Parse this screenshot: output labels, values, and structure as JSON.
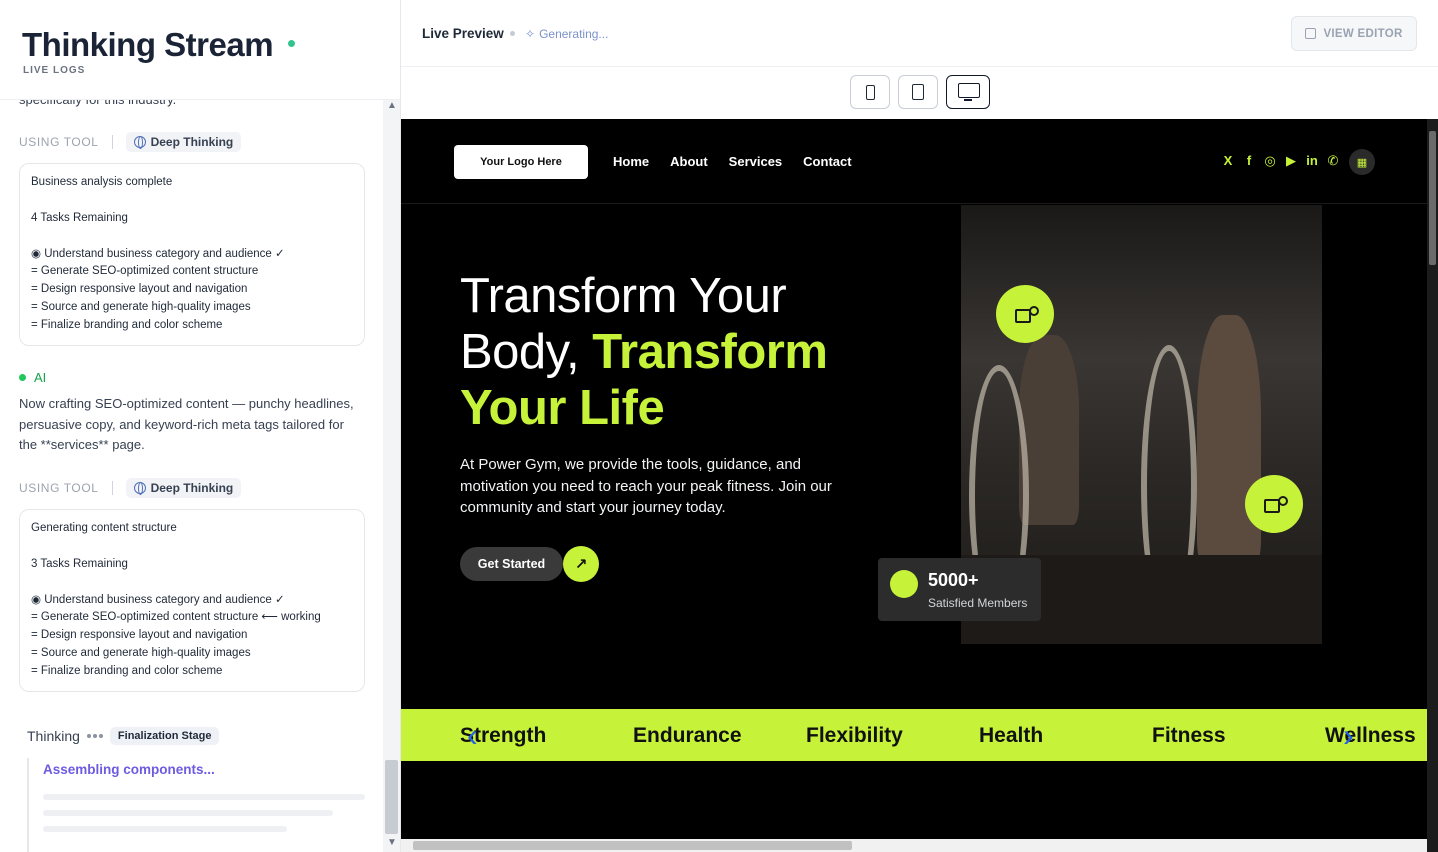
{
  "left": {
    "title": "Thinking Stream",
    "subtitle": "LIVE LOGS",
    "cut_text": "specifically for this industry.",
    "tool_blocks": [
      {
        "label": "USING TOOL",
        "tool": "Deep Thinking",
        "status": "Business analysis complete",
        "remaining": "4 Tasks Remaining",
        "tasks": [
          "◉ Understand business category and audience ✓",
          "= Generate SEO-optimized content structure",
          "= Design responsive layout and navigation",
          "= Source and generate high-quality images",
          "= Finalize branding and color scheme"
        ]
      },
      {
        "label": "USING TOOL",
        "tool": "Deep Thinking",
        "status": "Generating content structure",
        "remaining": "3 Tasks Remaining",
        "tasks": [
          "◉ Understand business category and audience ✓",
          "= Generate SEO-optimized content structure ⟵ working",
          "= Design responsive layout and navigation",
          "= Source and generate high-quality images",
          "= Finalize branding and color scheme"
        ]
      }
    ],
    "ai_label": "AI",
    "ai_text": "Now crafting SEO-optimized content — punchy headlines, persuasive copy, and keyword-rich meta tags tailored for the **services** page.",
    "thinking_label": "Thinking",
    "stage": "Finalization Stage",
    "assembling": "Assembling components..."
  },
  "topbar": {
    "title": "Live Preview",
    "status": "Generating...",
    "view_editor": "VIEW EDITOR"
  },
  "site": {
    "logo": "Your Logo Here",
    "nav": [
      "Home",
      "About",
      "Services",
      "Contact"
    ],
    "socials": [
      "X",
      "f",
      "◎",
      "▶",
      "in",
      "✆"
    ],
    "hero_line1": "Transform Your",
    "hero_line2a": "Body, ",
    "hero_line2b": "Transform",
    "hero_line3": "Your Life",
    "description": "At Power Gym, we provide the tools, guidance, and motivation you need to reach your peak fitness. Join our community and start your journey today.",
    "cta": "Get Started",
    "stat_number": "5000+",
    "stat_label": "Satisfied Members",
    "marquee": [
      "Strength",
      "Endurance",
      "Flexibility",
      "Health",
      "Fitness",
      "Wellness"
    ]
  },
  "colors": {
    "accent": "#c7f23a",
    "ai_green": "#22c55e",
    "purple": "#6d5be0"
  }
}
